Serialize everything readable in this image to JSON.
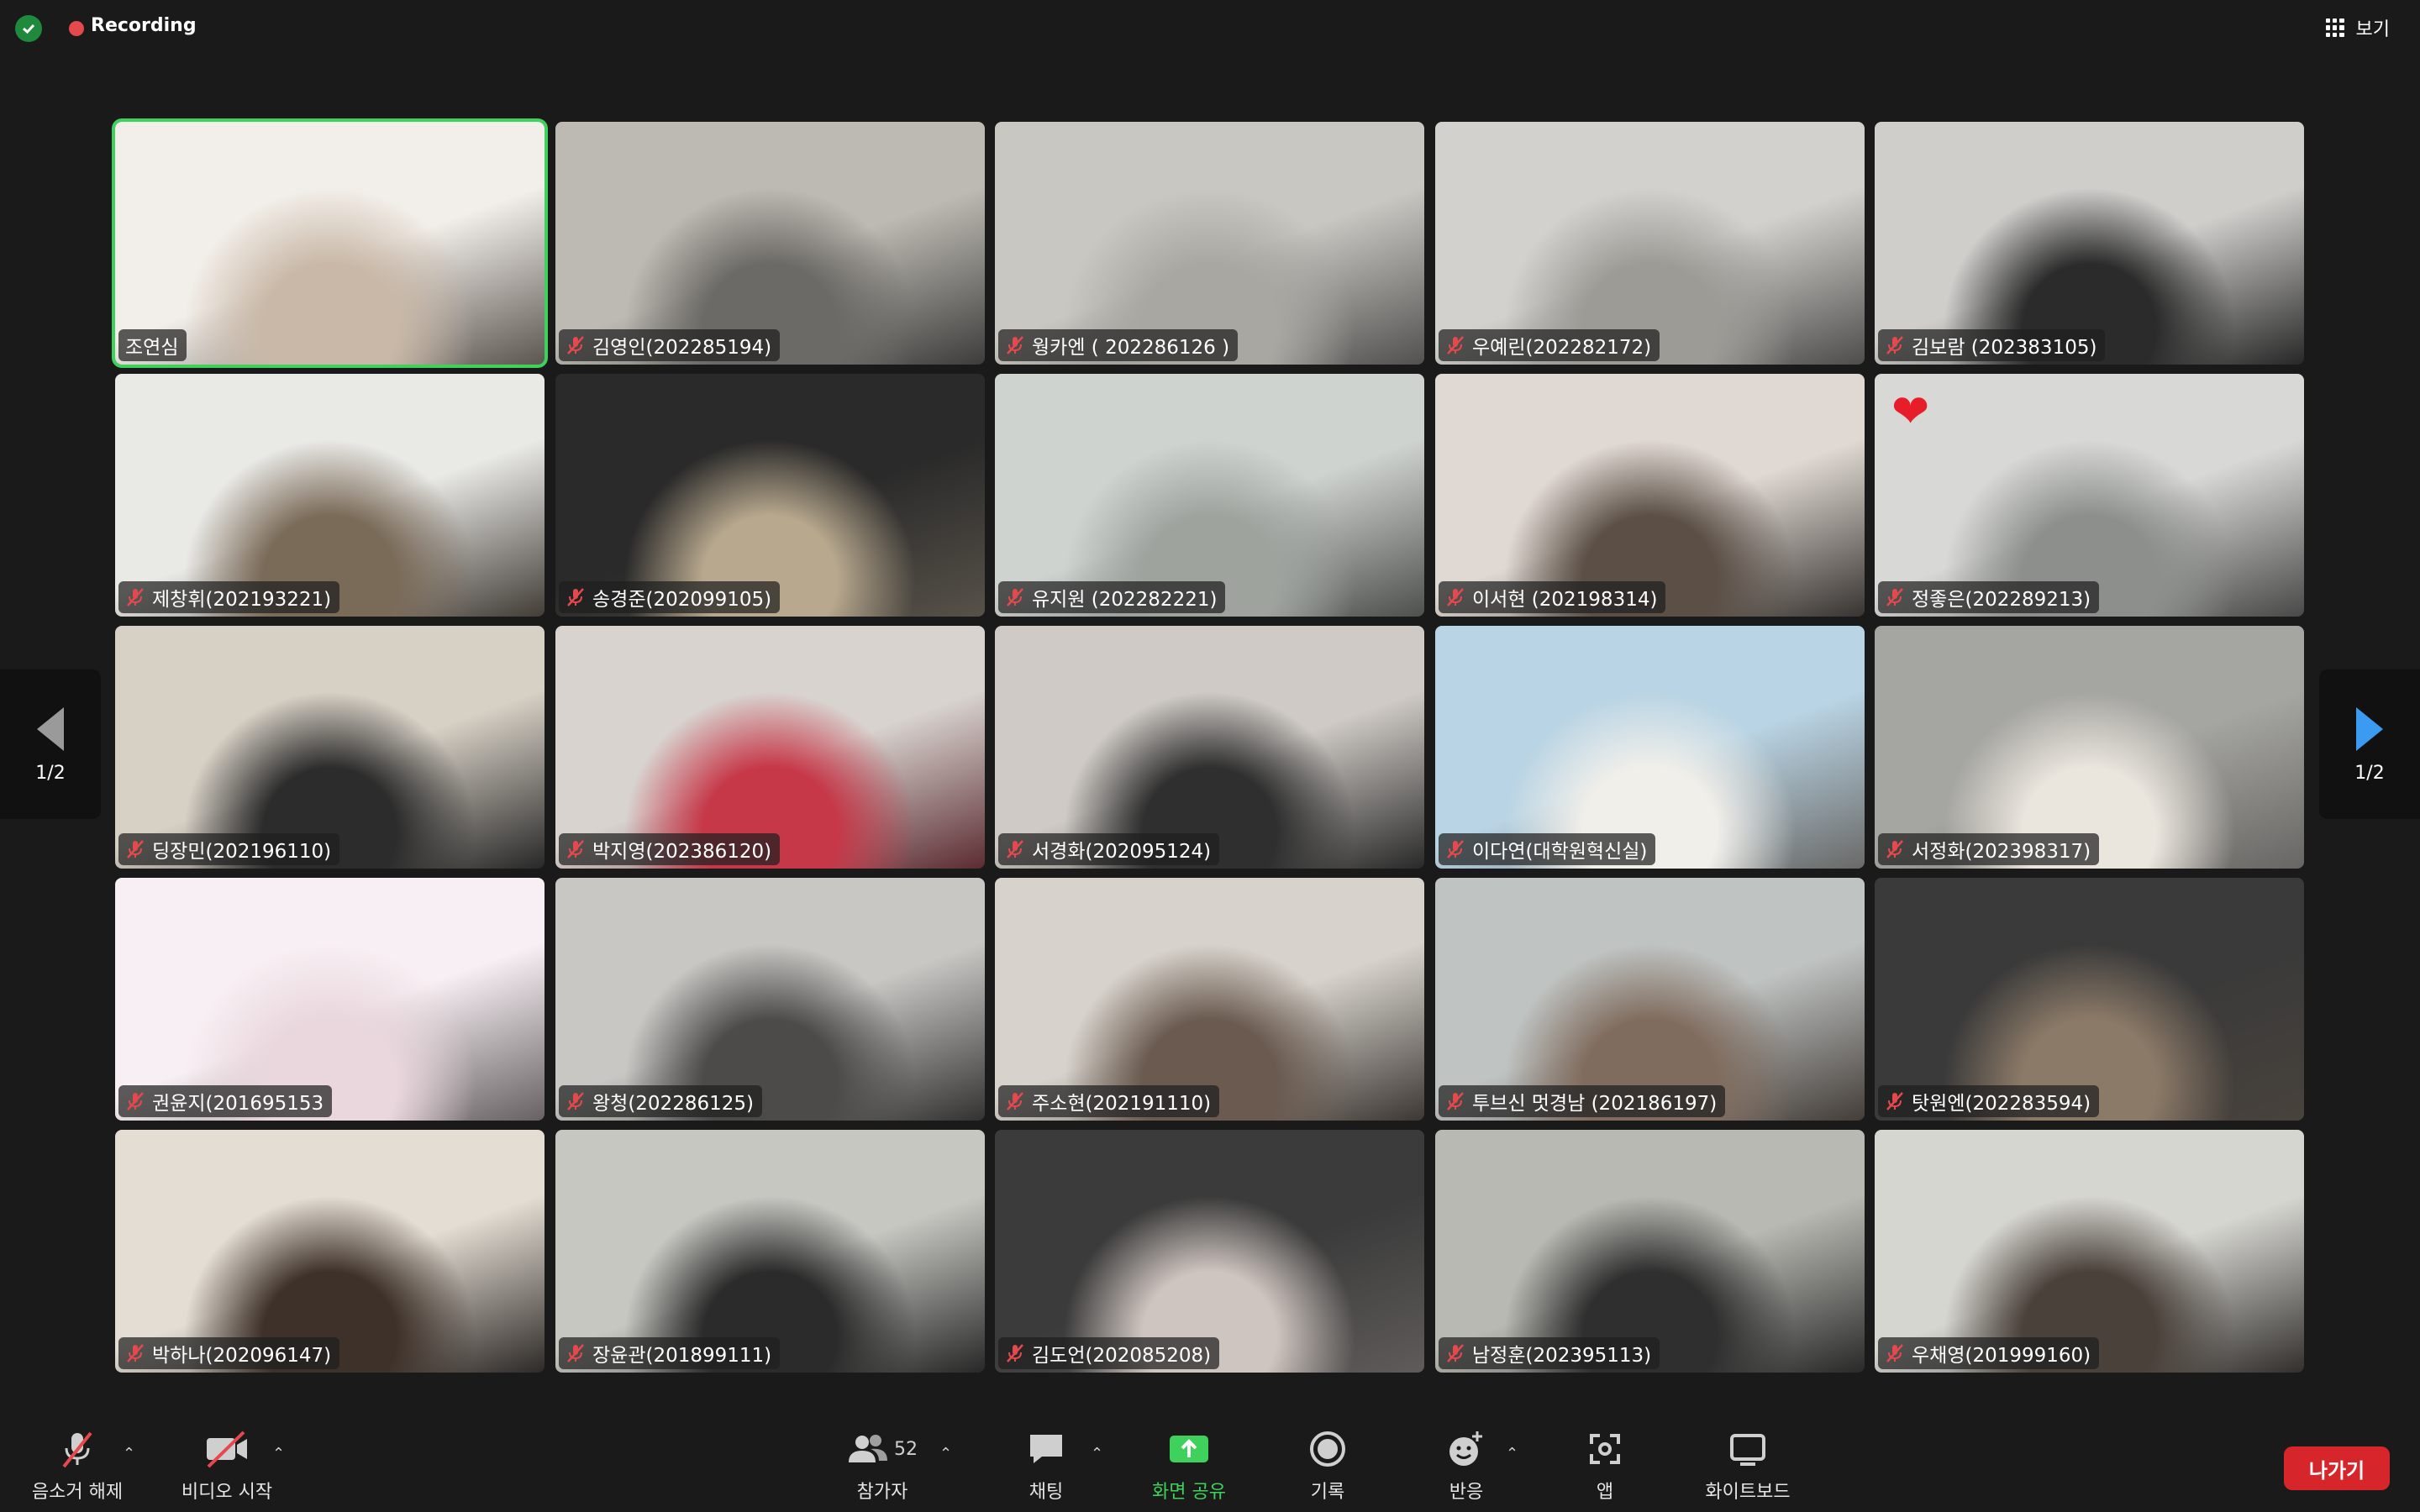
{
  "topbar": {
    "recording_label": "Recording",
    "view_label": "보기"
  },
  "pagination": {
    "left_label": "1/2",
    "right_label": "1/2"
  },
  "participants": [
    {
      "name": "조연심",
      "muted": false,
      "active": true
    },
    {
      "name": "김영인(202285194)",
      "muted": true
    },
    {
      "name": "웡카엔 ( 202286126 )",
      "muted": true
    },
    {
      "name": "우예린(202282172)",
      "muted": true
    },
    {
      "name": "김보람 (202383105)",
      "muted": true
    },
    {
      "name": "제창휘(202193221)",
      "muted": true
    },
    {
      "name": "송경준(202099105)",
      "muted": true
    },
    {
      "name": "유지원 (202282221)",
      "muted": true
    },
    {
      "name": "이서현 (202198314)",
      "muted": true
    },
    {
      "name": "정좋은(202289213)",
      "muted": true,
      "reaction": "heart"
    },
    {
      "name": "딩장민(202196110)",
      "muted": true
    },
    {
      "name": "박지영(202386120)",
      "muted": true
    },
    {
      "name": "서경화(202095124)",
      "muted": true
    },
    {
      "name": "이다연(대학원혁신실)",
      "muted": true
    },
    {
      "name": "서정화(202398317)",
      "muted": true
    },
    {
      "name": "권윤지(201695153",
      "muted": true
    },
    {
      "name": "왕청(202286125)",
      "muted": true
    },
    {
      "name": "주소현(202191110)",
      "muted": true
    },
    {
      "name": "투브신 멋경남 (202186197)",
      "muted": true
    },
    {
      "name": "탓원엔(202283594)",
      "muted": true
    },
    {
      "name": "박하나(202096147)",
      "muted": true
    },
    {
      "name": "장윤관(201899111)",
      "muted": true
    },
    {
      "name": "김도언(202085208)",
      "muted": true
    },
    {
      "name": "남정훈(202395113)",
      "muted": true
    },
    {
      "name": "우채영(201999160)",
      "muted": true
    }
  ],
  "toolbar": {
    "unmute_label": "음소거 해제",
    "start_video_label": "비디오 시작",
    "participants_label": "참가자",
    "participants_count": "52",
    "chat_label": "채팅",
    "share_screen_label": "화면 공유",
    "record_label": "기록",
    "reactions_label": "반응",
    "apps_label": "앱",
    "whiteboard_label": "화이트보드",
    "leave_label": "나가기"
  },
  "colors": {
    "background": "#1a1a1a",
    "active_speaker_border": "#3ed15b",
    "recording_dot": "#e5484d",
    "leave_button": "#d6262c",
    "share_green": "#3ed15b",
    "nav_arrow": "#3b9bf0"
  }
}
